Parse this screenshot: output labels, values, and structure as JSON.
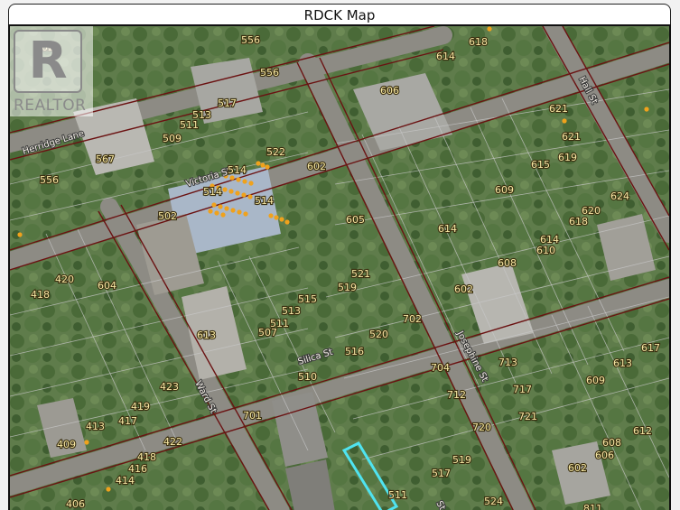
{
  "title": "RDCK Map",
  "watermark": {
    "text": "REALTOR",
    "symbol": "R"
  },
  "colors": {
    "property_line": "#6b1212",
    "parcel_line": "#c8c8c8",
    "subject_parcel": "#4fe3f0",
    "point_marker": "#f0a21c"
  },
  "streets": [
    {
      "name": "Herridge Lane"
    },
    {
      "name": "Victoria St"
    },
    {
      "name": "Silica St"
    },
    {
      "name": "Ward St"
    },
    {
      "name": "Josephine St"
    },
    {
      "name": "Hall St"
    },
    {
      "name": "St"
    }
  ],
  "lots": [
    "602",
    "556",
    "556",
    "618",
    "614",
    "606",
    "621",
    "621",
    "615",
    "619",
    "517",
    "513",
    "511",
    "509",
    "522",
    "602",
    "567",
    "556",
    "514",
    "514",
    "514",
    "609",
    "624",
    "620",
    "618",
    "614",
    "605",
    "614",
    "610",
    "608",
    "502",
    "521",
    "519",
    "420",
    "604",
    "418",
    "515",
    "513",
    "511",
    "507",
    "613",
    "602",
    "702",
    "520",
    "516",
    "617",
    "713",
    "613",
    "609",
    "704",
    "717",
    "712",
    "510",
    "423",
    "419",
    "417",
    "413",
    "409",
    "701",
    "721",
    "720",
    "612",
    "608",
    "606",
    "602",
    "519",
    "517",
    "422",
    "418",
    "416",
    "414",
    "406",
    "511",
    "524",
    "811"
  ]
}
